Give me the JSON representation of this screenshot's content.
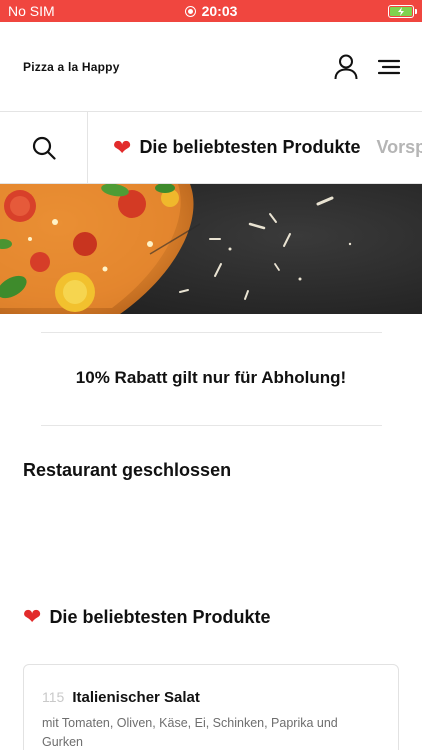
{
  "status_bar": {
    "carrier": "No SIM",
    "time": "20:03",
    "colors": {
      "background": "#f0463f",
      "battery_fill": "#7fd34e"
    }
  },
  "header": {
    "brand": "Pizza a la Happy",
    "icons": [
      "user-icon",
      "menu-icon"
    ]
  },
  "category_bar": {
    "icons": [
      "search-icon"
    ],
    "items": [
      {
        "label": "Die beliebtesten Produkte",
        "icon": "heart-icon",
        "active": true
      },
      {
        "label": "Vorspeisen",
        "active": false
      }
    ]
  },
  "banner": {
    "icon": "pizza-image"
  },
  "promo": {
    "text": "10% Rabatt gilt nur für Abholung!"
  },
  "status_message": {
    "text": "Restaurant geschlossen"
  },
  "section": {
    "title": "Die beliebtesten Produkte",
    "icon": "heart-icon"
  },
  "products": [
    {
      "number": "115",
      "name": "Italienischer Salat",
      "description": "mit Tomaten, Oliven, Käse, Ei, Schinken, Paprika und Gurken"
    }
  ],
  "colors": {
    "accent": "#f0463f",
    "heart": "#e22b2b",
    "muted_text": "#6e6e6e",
    "divider": "#e4e4e4"
  }
}
